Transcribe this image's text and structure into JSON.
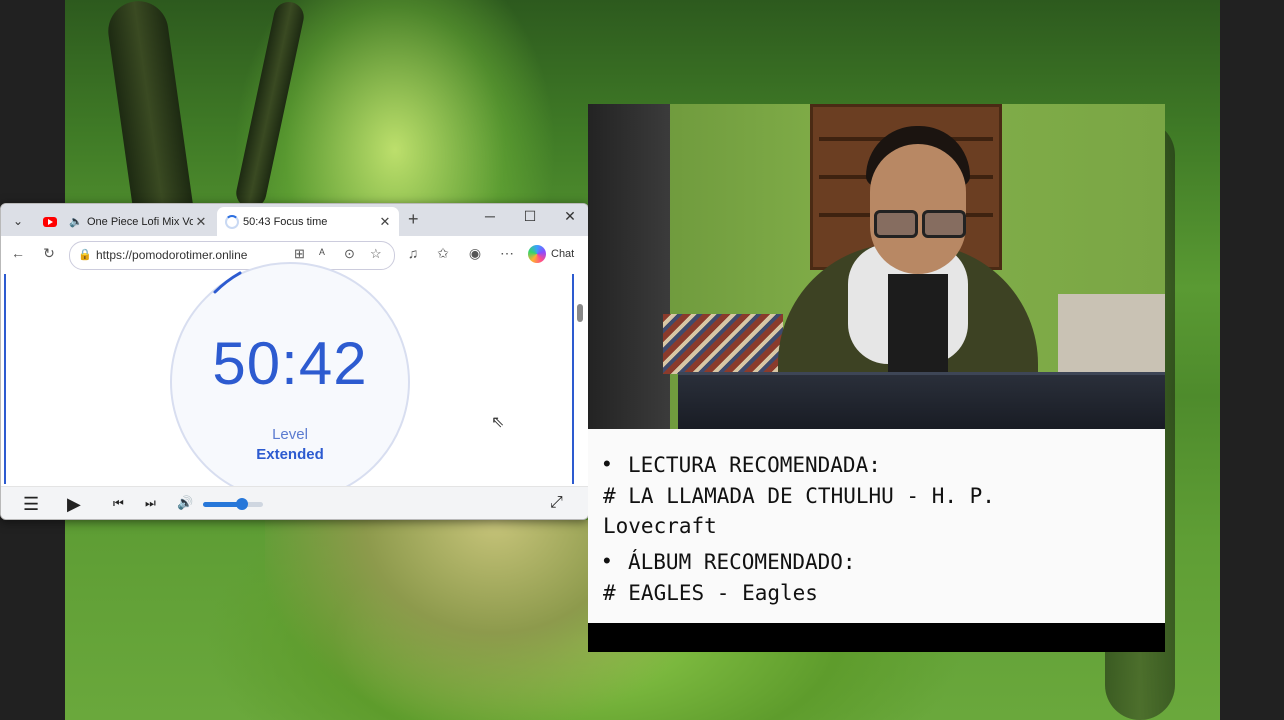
{
  "browser": {
    "tabs": [
      {
        "label": "One Piece Lofi Mix Vol.I",
        "close": "✕"
      },
      {
        "label": "50:43 Focus time",
        "close": "✕"
      }
    ],
    "new_tab": "+",
    "window_controls": {
      "minimize": "─",
      "maximize": "☐",
      "close": "✕"
    },
    "address": "https://pomodorotimer.online",
    "chat_label": "Chat"
  },
  "timer": {
    "time": "50:42",
    "level_label": "Level",
    "level_value": "Extended"
  },
  "player": {
    "volume_level_pct": 65
  },
  "note": {
    "bullet": "•",
    "heading1": "LECTURA RECOMENDADA:",
    "line1": "# LA LLAMADA DE CTHULHU - H. P.",
    "line1b": "Lovecraft",
    "heading2": "ÁLBUM RECOMENDADO:",
    "line2": "# EAGLES - Eagles"
  },
  "colors": {
    "accent": "#2d5bd0",
    "volume": "#2777d9"
  }
}
